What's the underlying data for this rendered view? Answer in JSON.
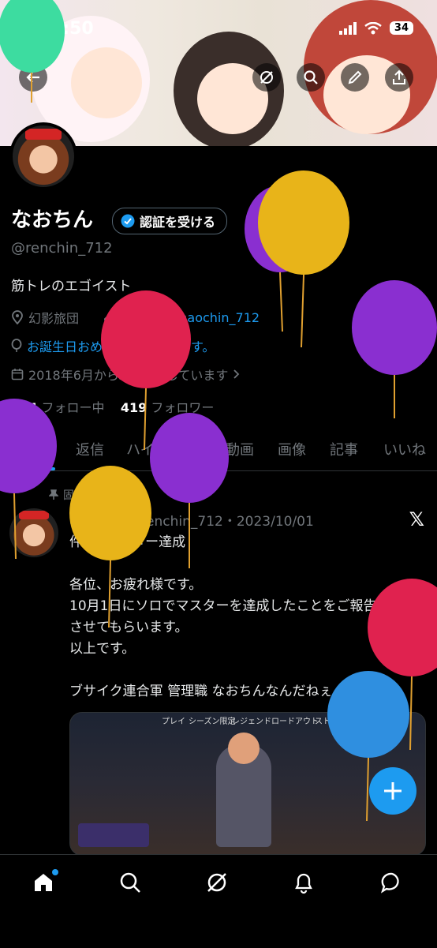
{
  "status_bar": {
    "time": "7:50",
    "battery": "34"
  },
  "profile": {
    "name": "なおちん",
    "verify_label": "認証を受ける",
    "handle": "@renchin_712",
    "bio": "筋トレのエゴイスト",
    "location": "幻影旅団",
    "link": "twitch.tv/naochin_712",
    "birthday": "お誕生日おめでとうございます。",
    "joined": "2018年6月からXを利用しています",
    "following_count": "364",
    "following_label": "フォロー中",
    "followers_count": "419",
    "followers_label": "フォロワー"
  },
  "tabs": [
    {
      "label": "ポスト"
    },
    {
      "label": "返信"
    },
    {
      "label": "ハイライト"
    },
    {
      "label": "動画"
    },
    {
      "label": "画像"
    },
    {
      "label": "記事"
    },
    {
      "label": "いいね"
    }
  ],
  "post": {
    "pinned_label": "固定",
    "author": "なおちん",
    "handle_date": "@renchin_712・2023/10/01",
    "lines": [
      "件名: マスター達成",
      "",
      "各位、お疲れ様です。",
      "10月1日にソロでマスターを達成したことをご報告",
      "させてもらいます。",
      "以上です。",
      "",
      "ブサイク連合軍 管理職 なおちんなんだねぇ"
    ],
    "media_tabs": [
      "プレイ",
      "シーズン限定",
      "レジェンド",
      "ロードアウト",
      "ストア",
      "クラブ"
    ]
  },
  "icons": {
    "back": "back-arrow-icon",
    "grok": "grok-icon",
    "search": "search-icon",
    "edit": "edit-icon",
    "share": "share-icon",
    "location": "location-pin-icon",
    "link": "link-icon",
    "balloon": "balloon-icon",
    "calendar": "calendar-icon",
    "pin": "pin-icon",
    "verified": "verified-badge-icon",
    "compose": "compose-plus-icon"
  },
  "colors": {
    "accent": "#1d9bf0",
    "background": "#000000",
    "muted": "#71767b"
  }
}
